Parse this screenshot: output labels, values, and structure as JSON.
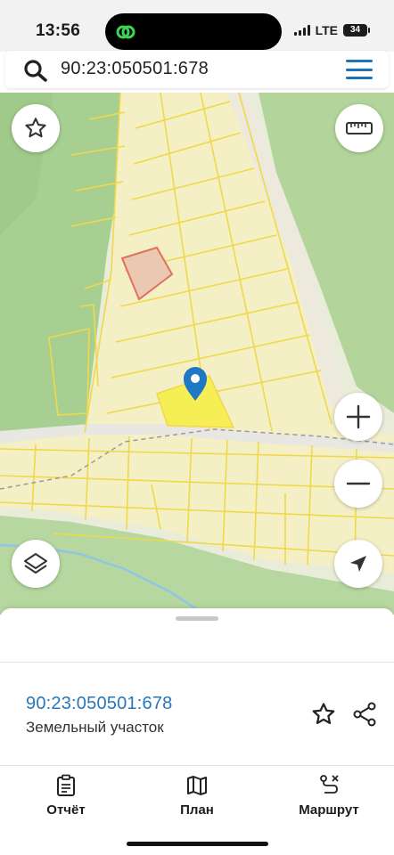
{
  "status_bar": {
    "time": "13:56",
    "network": "LTE",
    "battery": "34"
  },
  "search": {
    "query": "90:23:050501:678",
    "icon": "search-icon"
  },
  "map": {
    "controls": [
      "favorite-star-icon",
      "ruler-icon",
      "zoom-in-icon",
      "zoom-out-icon",
      "layers-icon",
      "locate-arrow-icon"
    ],
    "colors": {
      "forest": "#a9cf94",
      "parcel_fill": "#f3ebb6",
      "parcel_line": "#f2d84f",
      "selected_parcel": "#f6ee55",
      "marker": "#1f78c3",
      "road": "#e9e7e2",
      "river": "#8fc6e4",
      "highlight_parcel": "#e08070"
    }
  },
  "parcel": {
    "cadastral_number": "90:23:050501:678",
    "type": "Земельный участок"
  },
  "bottom_nav": {
    "items": [
      {
        "label": "Отчёт",
        "icon": "report-clipboard-icon"
      },
      {
        "label": "План",
        "icon": "map-plan-icon"
      },
      {
        "label": "Маршрут",
        "icon": "route-icon"
      }
    ]
  }
}
